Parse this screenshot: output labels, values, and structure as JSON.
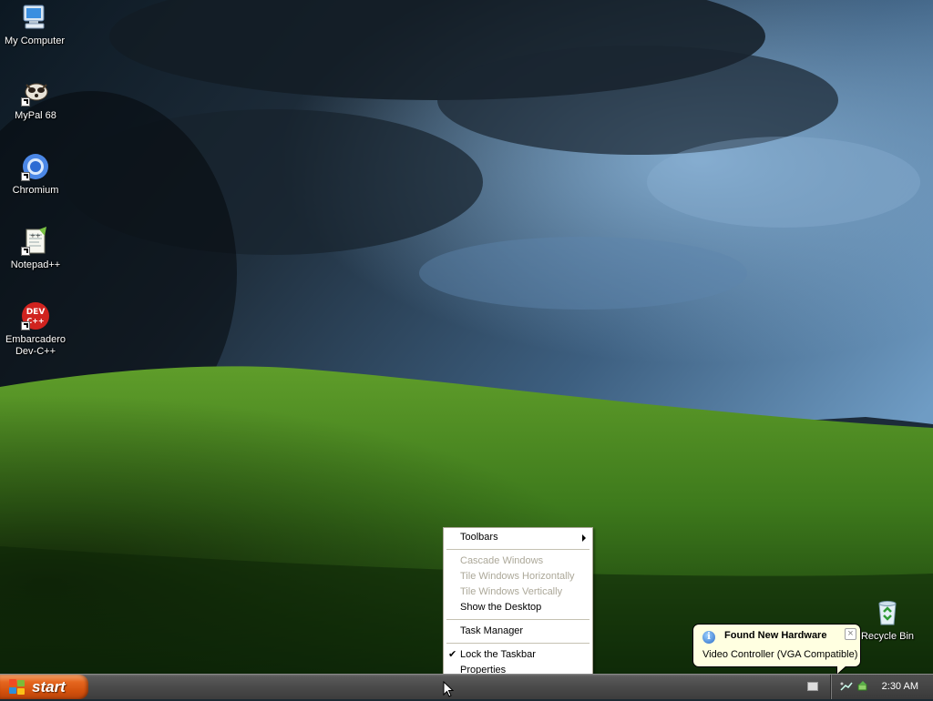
{
  "desktop": {
    "icons": [
      {
        "label": "My Computer",
        "icon": "computer-icon"
      },
      {
        "label": "MyPal 68",
        "icon": "mypal-icon"
      },
      {
        "label": "Chromium",
        "icon": "chromium-icon"
      },
      {
        "label": "Notepad++",
        "icon": "notepad-plus-plus-icon"
      },
      {
        "label": "Embarcadero Dev-C++",
        "icon": "dev-cpp-icon",
        "icon_text": "DEV"
      },
      {
        "label": "Recycle Bin",
        "icon": "recycle-bin-icon"
      }
    ]
  },
  "taskbar": {
    "start_label": "start",
    "clock": "2:30 AM",
    "tray_icons": [
      "keyboard-icon",
      "network-icon",
      "safely-remove-icon"
    ]
  },
  "context_menu": {
    "items": [
      {
        "label": "Toolbars",
        "enabled": true,
        "submenu": true
      },
      {
        "label": "Cascade Windows",
        "enabled": false
      },
      {
        "label": "Tile Windows Horizontally",
        "enabled": false
      },
      {
        "label": "Tile Windows Vertically",
        "enabled": false
      },
      {
        "label": "Show the Desktop",
        "enabled": true
      },
      {
        "label": "Task Manager",
        "enabled": true
      },
      {
        "label": "Lock the Taskbar",
        "enabled": true,
        "checked": true
      },
      {
        "label": "Properties",
        "enabled": true
      }
    ]
  },
  "balloon": {
    "title": "Found New Hardware",
    "body": "Video Controller (VGA Compatible)",
    "close_symbol": "×"
  },
  "colors": {
    "start_button": "#e5661f",
    "taskbar": "#4a4a4a",
    "balloon_bg": "#ffffe1",
    "menu_disabled": "#aca899"
  }
}
